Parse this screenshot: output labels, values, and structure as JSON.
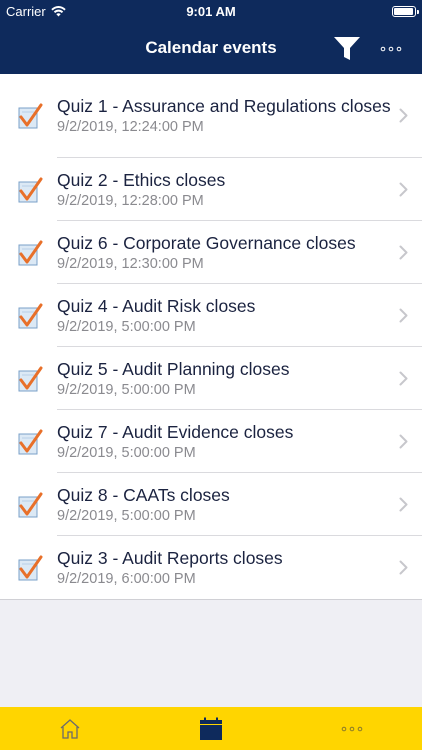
{
  "status": {
    "carrier": "Carrier",
    "time": "9:01 AM"
  },
  "nav": {
    "title": "Calendar events"
  },
  "events": [
    {
      "title": "Quiz 1 - Assurance and Regulations closes",
      "date": "9/2/2019, 12:24:00 PM"
    },
    {
      "title": "Quiz 2 - Ethics closes",
      "date": "9/2/2019, 12:28:00 PM"
    },
    {
      "title": "Quiz 6 - Corporate Governance closes",
      "date": "9/2/2019, 12:30:00 PM"
    },
    {
      "title": "Quiz 4 - Audit Risk closes",
      "date": "9/2/2019, 5:00:00 PM"
    },
    {
      "title": "Quiz 5 - Audit Planning closes",
      "date": "9/2/2019, 5:00:00 PM"
    },
    {
      "title": "Quiz 7 - Audit Evidence closes",
      "date": "9/2/2019, 5:00:00 PM"
    },
    {
      "title": "Quiz 8 - CAATs closes",
      "date": "9/2/2019, 5:00:00 PM"
    },
    {
      "title": "Quiz 3 - Audit Reports closes",
      "date": "9/2/2019, 6:00:00 PM"
    }
  ],
  "icons": {
    "row_icon": "quiz-checkbox-icon",
    "row_chevron": "chevron-right-icon",
    "filter": "filter-icon",
    "more": "more-dots-icon",
    "tab_home": "home-icon",
    "tab_calendar": "calendar-icon",
    "tab_more": "more-dots-icon"
  },
  "colors": {
    "nav_bg": "#0e2a5c",
    "tab_bar_bg": "#ffd500",
    "check": "#e8702a"
  }
}
